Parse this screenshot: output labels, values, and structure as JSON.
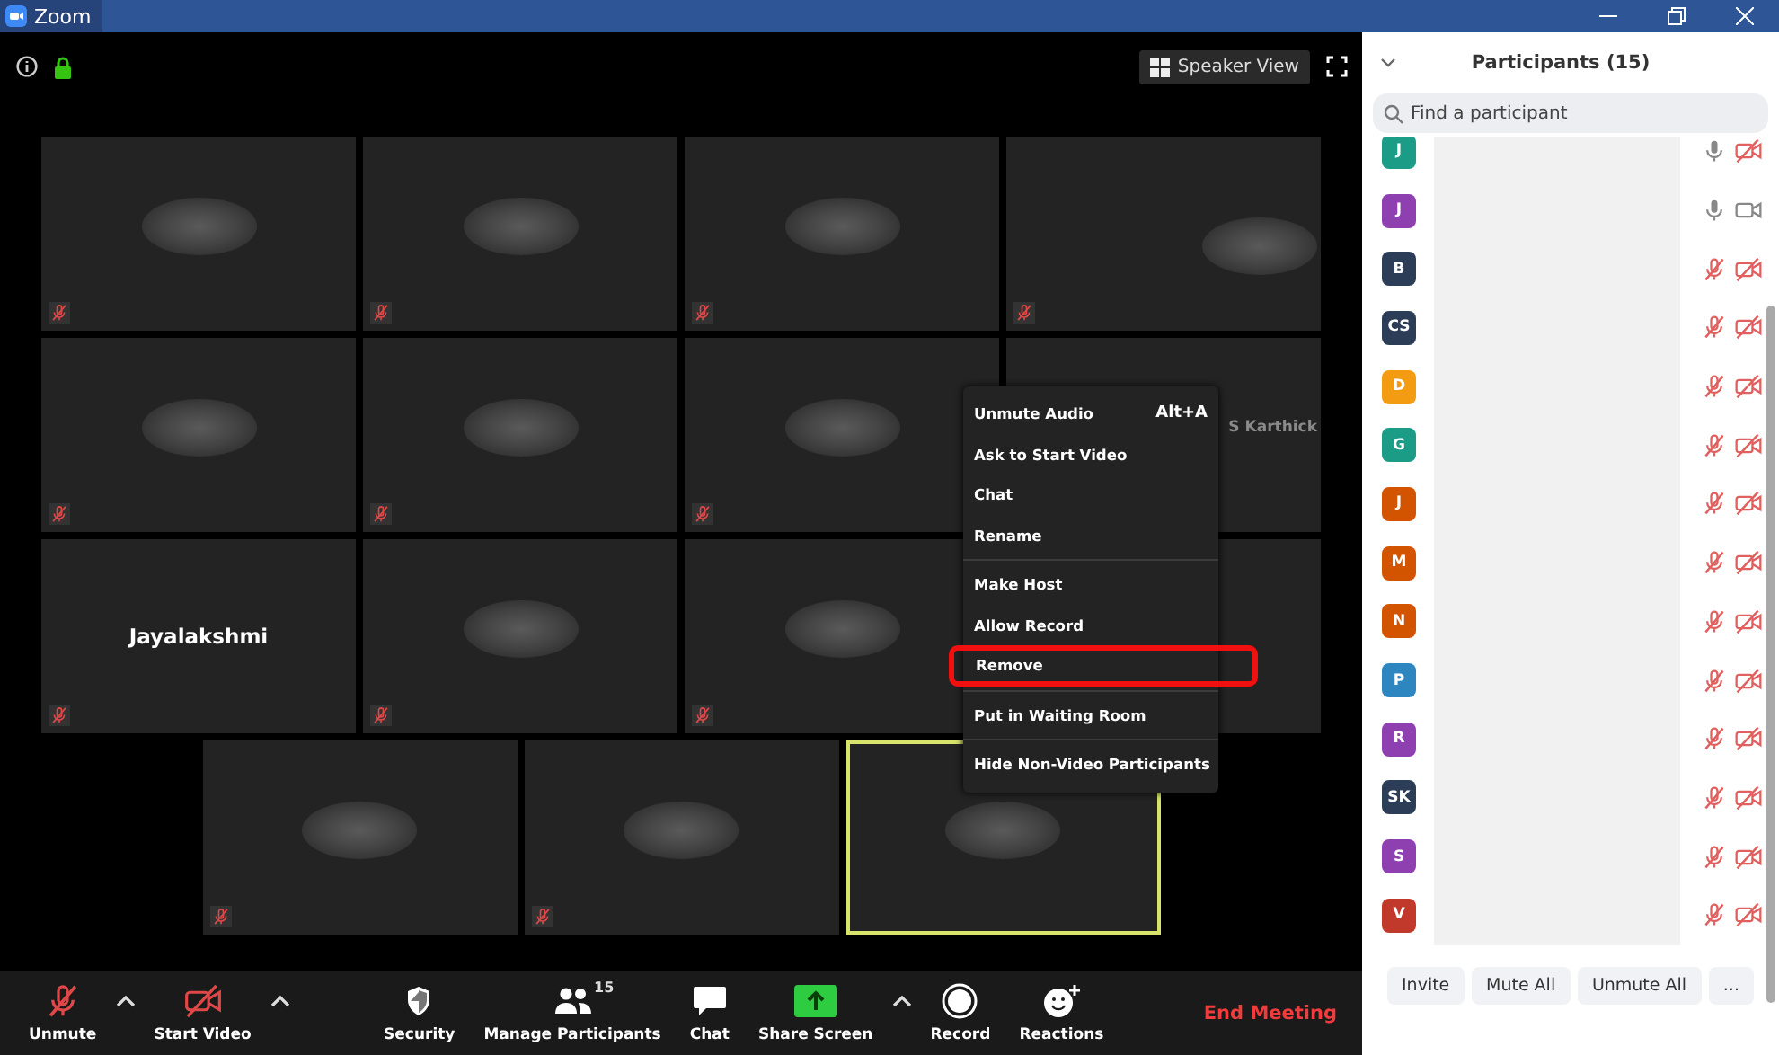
{
  "window": {
    "title": "Zoom"
  },
  "top_bar": {
    "view_button": "Speaker View"
  },
  "video_rows": [
    {
      "tiles": [
        {
          "kind": "video",
          "muted": true,
          "speaking": false
        },
        {
          "kind": "video",
          "muted": true,
          "speaking": false
        },
        {
          "kind": "video",
          "muted": true,
          "speaking": false
        },
        {
          "kind": "video",
          "muted": true,
          "speaking": false
        }
      ]
    },
    {
      "tiles": [
        {
          "kind": "video",
          "muted": true,
          "speaking": false
        },
        {
          "kind": "video",
          "muted": true,
          "speaking": false
        },
        {
          "kind": "video",
          "muted": true,
          "speaking": false
        },
        {
          "kind": "name",
          "name": "S Karthick",
          "muted": false,
          "speaking": false
        }
      ]
    },
    {
      "tiles": [
        {
          "kind": "name",
          "name": "Jayalakshmi",
          "muted": true,
          "speaking": false
        },
        {
          "kind": "video",
          "muted": true,
          "speaking": false
        },
        {
          "kind": "video",
          "muted": true,
          "speaking": false
        },
        {
          "kind": "blank",
          "muted": false,
          "speaking": false
        }
      ]
    },
    {
      "tiles": [
        {
          "kind": "video",
          "muted": true,
          "speaking": false
        },
        {
          "kind": "video",
          "muted": true,
          "speaking": false
        },
        {
          "kind": "video",
          "muted": false,
          "speaking": true
        }
      ]
    }
  ],
  "context_menu": {
    "groups": [
      {
        "items": [
          {
            "label": "Unmute Audio",
            "shortcut": "Alt+A",
            "highlighted": false
          },
          {
            "label": "Ask to Start Video",
            "highlighted": false
          },
          {
            "label": "Chat",
            "highlighted": false
          },
          {
            "label": "Rename",
            "highlighted": false
          }
        ]
      },
      {
        "items": [
          {
            "label": "Make Host",
            "highlighted": false
          },
          {
            "label": "Allow Record",
            "highlighted": false
          },
          {
            "label": "Remove",
            "highlighted": true
          }
        ]
      },
      {
        "items": [
          {
            "label": "Put in Waiting Room",
            "highlighted": false
          }
        ]
      },
      {
        "items": [
          {
            "label": "Hide Non-Video Participants",
            "highlighted": false
          }
        ]
      }
    ]
  },
  "toolbar": {
    "items": [
      {
        "kind": "mic",
        "label": "Unmute"
      },
      {
        "kind": "caret"
      },
      {
        "kind": "video",
        "label": "Start Video"
      },
      {
        "kind": "caret"
      },
      {
        "kind": "spacer"
      },
      {
        "kind": "security",
        "label": "Security"
      },
      {
        "kind": "participants",
        "label": "Manage Participants",
        "count": "15"
      },
      {
        "kind": "chat",
        "label": "Chat"
      },
      {
        "kind": "share",
        "label": "Share Screen"
      },
      {
        "kind": "caret"
      },
      {
        "kind": "record",
        "label": "Record"
      },
      {
        "kind": "reactions",
        "label": "Reactions"
      },
      {
        "kind": "spacer"
      }
    ],
    "end_button": "End Meeting"
  },
  "participants_panel": {
    "title": "Participants (15)",
    "search": {
      "placeholder": "Find a participant"
    },
    "participants": [
      {
        "initials": "J",
        "color": "#1a9c86",
        "mic_muted": false,
        "video_off": true
      },
      {
        "initials": "J",
        "color": "#8e3fb0",
        "mic_muted": false,
        "video_off": false
      },
      {
        "initials": "B",
        "color": "#2c3e57",
        "mic_muted": true,
        "video_off": true
      },
      {
        "initials": "CS",
        "color": "#2c3e57",
        "mic_muted": true,
        "video_off": true
      },
      {
        "initials": "D",
        "color": "#f39c12",
        "mic_muted": true,
        "video_off": true
      },
      {
        "initials": "G",
        "color": "#1a9c86",
        "mic_muted": true,
        "video_off": true
      },
      {
        "initials": "J",
        "color": "#d35400",
        "mic_muted": true,
        "video_off": true
      },
      {
        "initials": "M",
        "color": "#d35400",
        "mic_muted": true,
        "video_off": true
      },
      {
        "initials": "N",
        "color": "#d35400",
        "mic_muted": true,
        "video_off": true
      },
      {
        "initials": "P",
        "color": "#2e86c1",
        "mic_muted": true,
        "video_off": true
      },
      {
        "initials": "R",
        "color": "#8e3fb0",
        "mic_muted": true,
        "video_off": true
      },
      {
        "initials": "SK",
        "color": "#2c3e57",
        "mic_muted": true,
        "video_off": true
      },
      {
        "initials": "S",
        "color": "#8e3fb0",
        "mic_muted": true,
        "video_off": true
      },
      {
        "initials": "V",
        "color": "#c0392b",
        "mic_muted": true,
        "video_off": true
      }
    ],
    "buttons": [
      "Invite",
      "Mute All",
      "Unmute All",
      "..."
    ]
  }
}
